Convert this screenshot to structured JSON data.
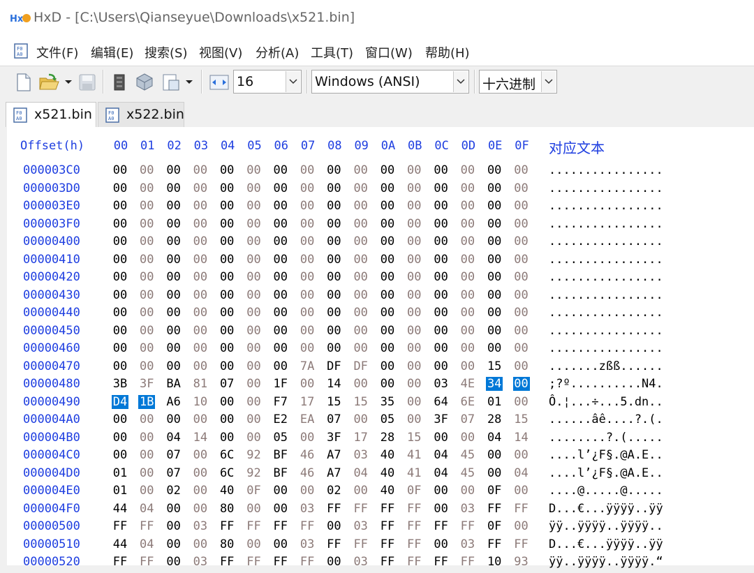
{
  "window": {
    "title": "HxD - [C:\\Users\\Qianseyue\\Downloads\\x521.bin]"
  },
  "menu": [
    "文件(F)",
    "编辑(E)",
    "搜索(S)",
    "视图(V)",
    "分析(A)",
    "工具(T)",
    "窗口(W)",
    "帮助(H)"
  ],
  "toolbar": {
    "bytes_per_row": "16",
    "charset": "Windows (ANSI)",
    "offset_base": "十六进制"
  },
  "tabs": [
    {
      "label": "x521.bin",
      "active": true
    },
    {
      "label": "x522.bin",
      "active": false
    }
  ],
  "editor": {
    "offset_header": "Offset(h)",
    "column_headers": [
      "00",
      "01",
      "02",
      "03",
      "04",
      "05",
      "06",
      "07",
      "08",
      "09",
      "0A",
      "0B",
      "0C",
      "0D",
      "0E",
      "0F"
    ],
    "text_header": "对应文本",
    "rows": [
      {
        "offset": "000003C0",
        "bytes": [
          "00",
          "00",
          "00",
          "00",
          "00",
          "00",
          "00",
          "00",
          "00",
          "00",
          "00",
          "00",
          "00",
          "00",
          "00",
          "00"
        ],
        "text": "................"
      },
      {
        "offset": "000003D0",
        "bytes": [
          "00",
          "00",
          "00",
          "00",
          "00",
          "00",
          "00",
          "00",
          "00",
          "00",
          "00",
          "00",
          "00",
          "00",
          "00",
          "00"
        ],
        "text": "................"
      },
      {
        "offset": "000003E0",
        "bytes": [
          "00",
          "00",
          "00",
          "00",
          "00",
          "00",
          "00",
          "00",
          "00",
          "00",
          "00",
          "00",
          "00",
          "00",
          "00",
          "00"
        ],
        "text": "................"
      },
      {
        "offset": "000003F0",
        "bytes": [
          "00",
          "00",
          "00",
          "00",
          "00",
          "00",
          "00",
          "00",
          "00",
          "00",
          "00",
          "00",
          "00",
          "00",
          "00",
          "00"
        ],
        "text": "................"
      },
      {
        "offset": "00000400",
        "bytes": [
          "00",
          "00",
          "00",
          "00",
          "00",
          "00",
          "00",
          "00",
          "00",
          "00",
          "00",
          "00",
          "00",
          "00",
          "00",
          "00"
        ],
        "text": "................"
      },
      {
        "offset": "00000410",
        "bytes": [
          "00",
          "00",
          "00",
          "00",
          "00",
          "00",
          "00",
          "00",
          "00",
          "00",
          "00",
          "00",
          "00",
          "00",
          "00",
          "00"
        ],
        "text": "................"
      },
      {
        "offset": "00000420",
        "bytes": [
          "00",
          "00",
          "00",
          "00",
          "00",
          "00",
          "00",
          "00",
          "00",
          "00",
          "00",
          "00",
          "00",
          "00",
          "00",
          "00"
        ],
        "text": "................"
      },
      {
        "offset": "00000430",
        "bytes": [
          "00",
          "00",
          "00",
          "00",
          "00",
          "00",
          "00",
          "00",
          "00",
          "00",
          "00",
          "00",
          "00",
          "00",
          "00",
          "00"
        ],
        "text": "................"
      },
      {
        "offset": "00000440",
        "bytes": [
          "00",
          "00",
          "00",
          "00",
          "00",
          "00",
          "00",
          "00",
          "00",
          "00",
          "00",
          "00",
          "00",
          "00",
          "00",
          "00"
        ],
        "text": "................"
      },
      {
        "offset": "00000450",
        "bytes": [
          "00",
          "00",
          "00",
          "00",
          "00",
          "00",
          "00",
          "00",
          "00",
          "00",
          "00",
          "00",
          "00",
          "00",
          "00",
          "00"
        ],
        "text": "................"
      },
      {
        "offset": "00000460",
        "bytes": [
          "00",
          "00",
          "00",
          "00",
          "00",
          "00",
          "00",
          "00",
          "00",
          "00",
          "00",
          "00",
          "00",
          "00",
          "00",
          "00"
        ],
        "text": "................"
      },
      {
        "offset": "00000470",
        "bytes": [
          "00",
          "00",
          "00",
          "00",
          "00",
          "00",
          "00",
          "7A",
          "DF",
          "DF",
          "00",
          "00",
          "00",
          "00",
          "15",
          "00"
        ],
        "text": ".......zßß......"
      },
      {
        "offset": "00000480",
        "bytes": [
          "3B",
          "3F",
          "BA",
          "81",
          "07",
          "00",
          "1F",
          "00",
          "14",
          "00",
          "00",
          "00",
          "03",
          "4E",
          "34",
          "00"
        ],
        "text": ";?º..........N4.",
        "selected": [
          14,
          15
        ]
      },
      {
        "offset": "00000490",
        "bytes": [
          "D4",
          "1B",
          "A6",
          "10",
          "00",
          "00",
          "F7",
          "17",
          "15",
          "15",
          "35",
          "00",
          "64",
          "6E",
          "01",
          "00"
        ],
        "text": "Ô.¦...÷...5.dn..",
        "selected": [
          0,
          1
        ]
      },
      {
        "offset": "000004A0",
        "bytes": [
          "00",
          "00",
          "00",
          "00",
          "00",
          "00",
          "E2",
          "EA",
          "07",
          "00",
          "05",
          "00",
          "3F",
          "07",
          "28",
          "15"
        ],
        "text": "......âê....?.(."
      },
      {
        "offset": "000004B0",
        "bytes": [
          "00",
          "00",
          "04",
          "14",
          "00",
          "00",
          "05",
          "00",
          "3F",
          "17",
          "28",
          "15",
          "00",
          "00",
          "04",
          "14"
        ],
        "text": "........?.(....."
      },
      {
        "offset": "000004C0",
        "bytes": [
          "00",
          "00",
          "07",
          "00",
          "6C",
          "92",
          "BF",
          "46",
          "A7",
          "03",
          "40",
          "41",
          "04",
          "45",
          "00",
          "00"
        ],
        "text": "....l’¿F§.@A.E.."
      },
      {
        "offset": "000004D0",
        "bytes": [
          "01",
          "00",
          "07",
          "00",
          "6C",
          "92",
          "BF",
          "46",
          "A7",
          "04",
          "40",
          "41",
          "04",
          "45",
          "00",
          "04"
        ],
        "text": "....l’¿F§.@A.E.."
      },
      {
        "offset": "000004E0",
        "bytes": [
          "01",
          "00",
          "02",
          "00",
          "40",
          "0F",
          "00",
          "00",
          "02",
          "00",
          "40",
          "0F",
          "00",
          "00",
          "0F",
          "00"
        ],
        "text": "....@.....@....."
      },
      {
        "offset": "000004F0",
        "bytes": [
          "44",
          "04",
          "00",
          "00",
          "80",
          "00",
          "00",
          "03",
          "FF",
          "FF",
          "FF",
          "FF",
          "00",
          "03",
          "FF",
          "FF"
        ],
        "text": "D...€...ÿÿÿÿ..ÿÿ"
      },
      {
        "offset": "00000500",
        "bytes": [
          "FF",
          "FF",
          "00",
          "03",
          "FF",
          "FF",
          "FF",
          "FF",
          "00",
          "03",
          "FF",
          "FF",
          "FF",
          "FF",
          "0F",
          "00"
        ],
        "text": "ÿÿ..ÿÿÿÿ..ÿÿÿÿ.."
      },
      {
        "offset": "00000510",
        "bytes": [
          "44",
          "04",
          "00",
          "00",
          "80",
          "00",
          "00",
          "03",
          "FF",
          "FF",
          "FF",
          "FF",
          "00",
          "03",
          "FF",
          "FF"
        ],
        "text": "D...€...ÿÿÿÿ..ÿÿ"
      },
      {
        "offset": "00000520",
        "bytes": [
          "FF",
          "FF",
          "00",
          "03",
          "FF",
          "FF",
          "FF",
          "FF",
          "00",
          "03",
          "FF",
          "FF",
          "FF",
          "FF",
          "10",
          "93"
        ],
        "text": "ÿÿ..ÿÿÿÿ..ÿÿÿÿ.“"
      }
    ]
  }
}
